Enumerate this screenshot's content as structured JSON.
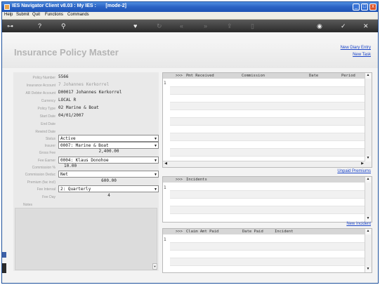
{
  "window": {
    "title": "IES Navigator Client v8.03 : My IES :       [mode-2]",
    "controls": [
      "_",
      "□",
      "x"
    ]
  },
  "menu": [
    "Help",
    "Submit",
    "Quit",
    "Functions",
    "Commands"
  ],
  "toolbar": {
    "icons": [
      "key-icon",
      "help-icon",
      "search-icon",
      "heart-icon",
      "refresh-icon",
      "rewind-icon",
      "forward-icon",
      "upload-icon",
      "page-icon",
      "camera-icon",
      "check-icon",
      "close-icon"
    ],
    "glyphs": [
      "⊶",
      "?",
      "⚲",
      "♥",
      "↻",
      "«",
      "»",
      "⇪",
      "▯",
      "◉",
      "✓",
      "✕"
    ]
  },
  "page": {
    "title": "Insurance Policy Master",
    "links": {
      "new_diary": "New Diary Entry",
      "new_task": "New Task"
    }
  },
  "form": {
    "policy_number": {
      "label": "Policy Number",
      "value": "5566"
    },
    "insurance_account": {
      "label": "Insurance Account",
      "value": "7 Johannes Kerkorrel"
    },
    "ar_debtor_account": {
      "label": "AR Debtor Account",
      "value": "D00017 Johannes Kerkorrel"
    },
    "currency": {
      "label": "Currency",
      "value": "LOCAL R"
    },
    "policy_type": {
      "label": "Policy Type",
      "value": "02 Marine & Boat"
    },
    "start_date": {
      "label": "Start Date",
      "value": "04/01/2007"
    },
    "end_date": {
      "label": "End Date",
      "value": ""
    },
    "rewind_date": {
      "label": "Rewind Date",
      "value": ""
    },
    "status": {
      "label": "Status",
      "value": "Active"
    },
    "insurer": {
      "label": "Insurer",
      "value": "0007: Marine & Boat"
    },
    "gross_fee": {
      "label": "Gross Fee",
      "value": "2,400.00"
    },
    "fee_earner": {
      "label": "Fee Earner",
      "value": "0004: Klaus Donohoe"
    },
    "commission_pct": {
      "label": "Commission %",
      "value": "10.00"
    },
    "commission_deduc": {
      "label": "Commission Deduc",
      "value": "Net"
    },
    "premium": {
      "label": "Premium (fac incl)",
      "value": "600.00"
    },
    "fee_interval": {
      "label": "Fee Interval",
      "value": "2: Quarterly"
    },
    "fee_day": {
      "label": "Fee Day",
      "value": "4"
    },
    "notes": {
      "label": "Notes",
      "value": ""
    }
  },
  "premiums_grid": {
    "headers": [
      ">>>",
      "Pmt Received",
      "Commission",
      "Date",
      "Period"
    ],
    "row_number": "1",
    "link": "Unpaid Premiums"
  },
  "incidents_grid": {
    "headers": [
      ">>>",
      "Incidents"
    ],
    "row_number": "1",
    "link": "New Incident"
  },
  "claims_grid": {
    "headers": [
      ">>>",
      "Claim Amt Paid",
      "Date Paid",
      "Incident"
    ],
    "row_number": "1"
  }
}
